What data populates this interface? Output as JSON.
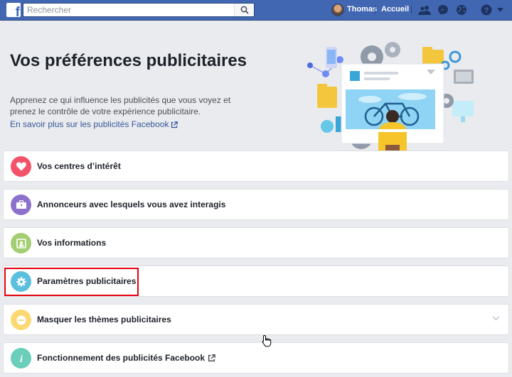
{
  "topbar": {
    "search_placeholder": "Rechercher",
    "user_name": "Thomas",
    "home_label": "Accueil",
    "brand_color": "#4267b2"
  },
  "header": {
    "title": "Vos préférences publicitaires",
    "description": "Apprenez ce qui influence les publicités que vous voyez et prenez le contrôle de votre expérience publicitaire.",
    "learn_more": "En savoir plus sur les publicités Facebook"
  },
  "sections": [
    {
      "label": "Vos centres d’intérêt",
      "icon": "heart-icon",
      "color": "#f35369"
    },
    {
      "label": "Annonceurs avec lesquels vous avez interagis",
      "icon": "briefcase-icon",
      "color": "#8c72cb"
    },
    {
      "label": "Vos informations",
      "icon": "contact-card-icon",
      "color": "#a3ce71"
    },
    {
      "label": "Paramètres publicitaires",
      "icon": "gear-icon",
      "color": "#5bc0de"
    },
    {
      "label": "Masquer les thèmes publicitaires",
      "icon": "minus-icon",
      "color": "#fcd872"
    },
    {
      "label": "Fonctionnement des publicités Facebook",
      "icon": "info-icon",
      "color": "#6bcebb"
    }
  ]
}
